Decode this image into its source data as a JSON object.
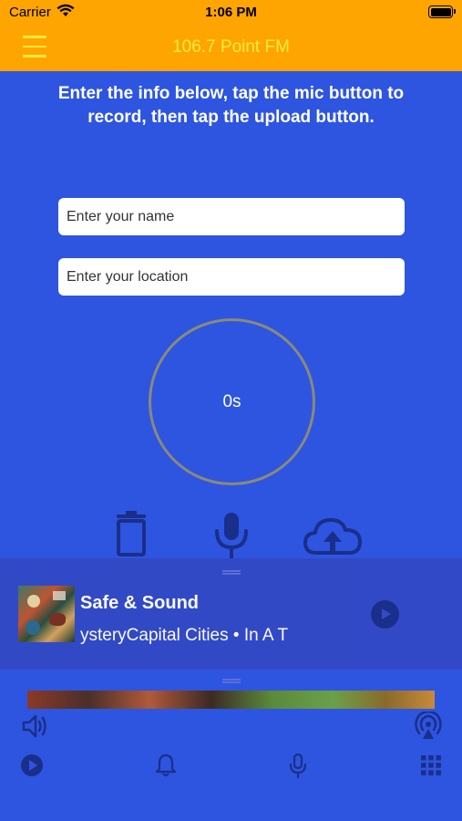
{
  "status_bar": {
    "carrier": "Carrier",
    "time": "1:06 PM"
  },
  "nav": {
    "title": "106.7 Point FM"
  },
  "instructions": "Enter the info below, tap the mic button to record, then tap the upload button.",
  "form": {
    "name_placeholder": "Enter your name",
    "location_placeholder": "Enter your location"
  },
  "recorder": {
    "elapsed": "0s"
  },
  "now_playing": {
    "title": "Safe & Sound",
    "subtitle": "ysteryCapital Cities • In A T"
  },
  "colors": {
    "header": "#ffa502",
    "header_text": "#ffeb3b",
    "background": "#2e55e0",
    "player": "#3349c6",
    "icon_dark": "#1a2f8a"
  },
  "icons": [
    "menu-icon",
    "trash-icon",
    "microphone-icon",
    "cloud-upload-icon",
    "play-icon",
    "volume-icon",
    "airplay-icon",
    "bell-icon",
    "grid-icon"
  ]
}
